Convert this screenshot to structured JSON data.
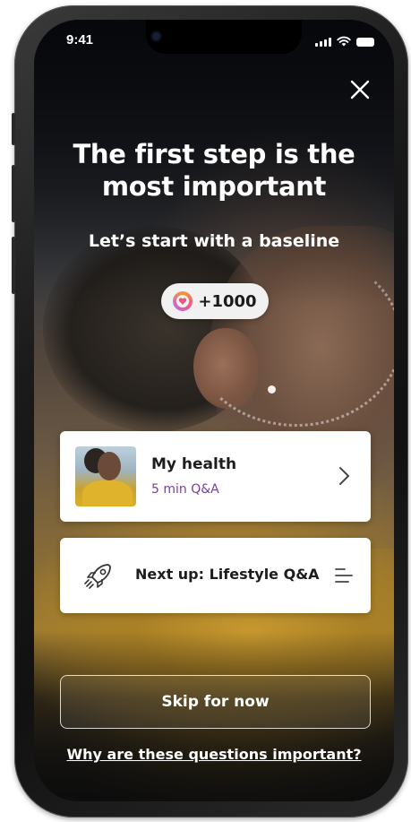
{
  "status_bar": {
    "time": "9:41"
  },
  "icons": {
    "close": "close-icon",
    "points": "reward-coin-icon",
    "chevron": "chevron-right-icon",
    "rocket": "rocket-icon",
    "list": "list-icon"
  },
  "header": {
    "title": "The first step is the most important",
    "subtitle": "Let’s start with a baseline"
  },
  "reward": {
    "points": "+1000"
  },
  "cards": {
    "current": {
      "title": "My health",
      "detail": "5 min Q&A"
    },
    "next": {
      "title": "Next up: Lifestyle Q&A"
    }
  },
  "actions": {
    "skip_label": "Skip for now",
    "why_link": "Why are these questions important?"
  },
  "colors": {
    "accent_purple": "#7a3e98",
    "card_background": "#ffffff",
    "text_light": "#ffffff"
  }
}
